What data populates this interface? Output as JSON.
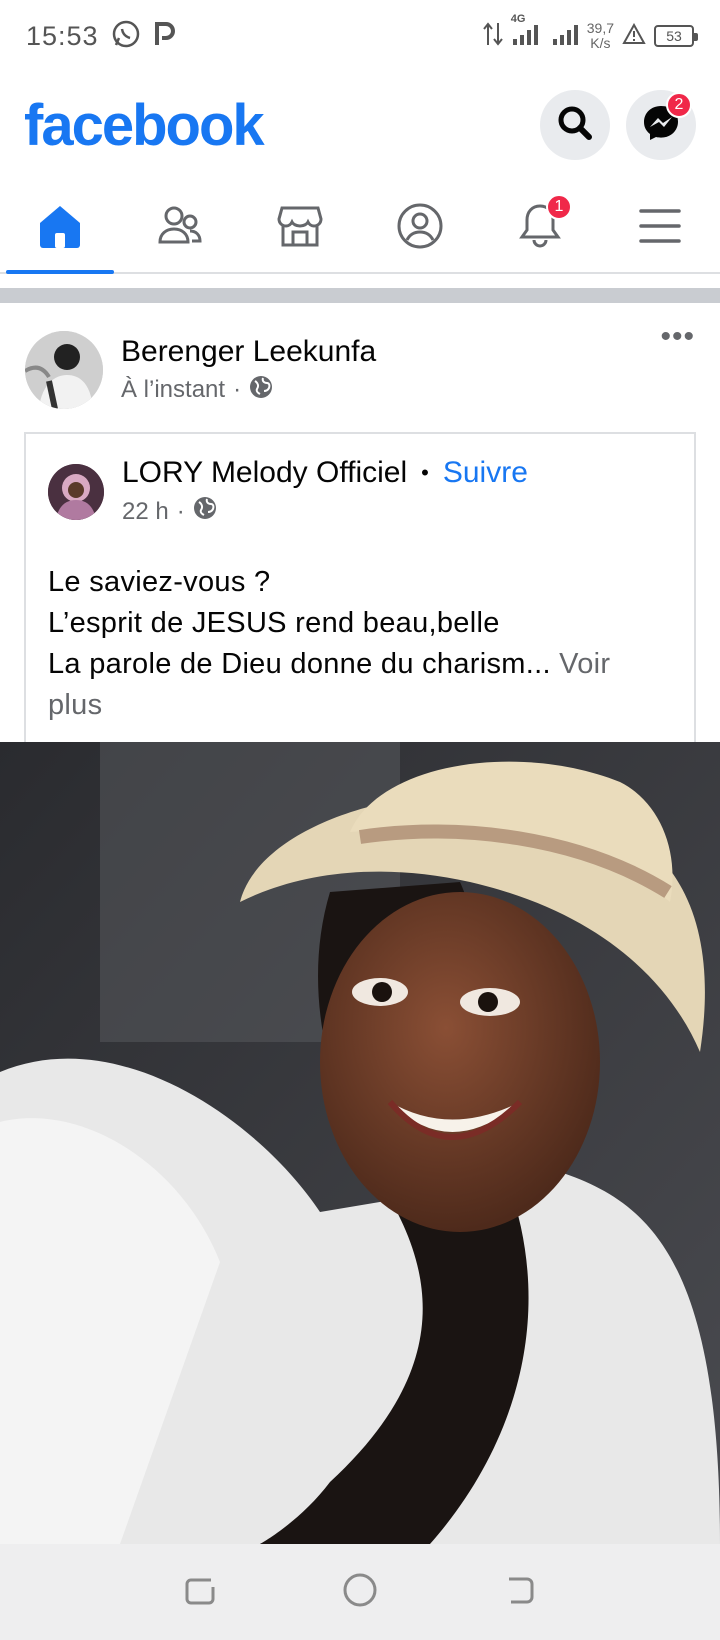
{
  "status_bar": {
    "time": "15:53",
    "network_type": "4G",
    "speed_value": "39,7",
    "speed_unit": "K/s",
    "battery": "53",
    "icons": [
      "whatsapp-icon",
      "p-app-icon",
      "data-arrows-icon",
      "signal-icon",
      "signal-icon-2",
      "alert-icon",
      "battery-icon"
    ]
  },
  "header": {
    "logo": "facebook",
    "messenger_badge": "2",
    "icons": [
      "search-icon",
      "messenger-icon"
    ]
  },
  "tabs": {
    "items": [
      {
        "name": "home",
        "icon": "home-icon",
        "active": true
      },
      {
        "name": "friends",
        "icon": "friends-icon",
        "active": false
      },
      {
        "name": "marketplace",
        "icon": "store-icon",
        "active": false
      },
      {
        "name": "profile",
        "icon": "profile-icon",
        "active": false
      },
      {
        "name": "notifications",
        "icon": "bell-icon",
        "active": false
      },
      {
        "name": "menu",
        "icon": "menu-icon",
        "active": false
      }
    ],
    "notifications_badge": "1"
  },
  "post": {
    "author": "Berenger Leekunfa",
    "time": "À l’instant",
    "separator": "·",
    "privacy_icon": "globe-icon",
    "more": "•••",
    "shared": {
      "author": "LORY Melody Officiel",
      "dot": "•",
      "follow": "Suivre",
      "time": "22 h",
      "separator": "·",
      "text_lines": [
        "Le saviez-vous ?",
        "L’esprit de JESUS rend beau,belle",
        "La parole de Dieu donne du charism..."
      ],
      "see_more": "Voir plus"
    }
  },
  "colors": {
    "brand": "#1877f2",
    "badge": "#f02849",
    "secondary_text": "#65676b",
    "divider": "#c9ccd1"
  },
  "nav_bar": {
    "icons": [
      "recent-apps-icon",
      "home-circle-icon",
      "back-icon"
    ]
  }
}
